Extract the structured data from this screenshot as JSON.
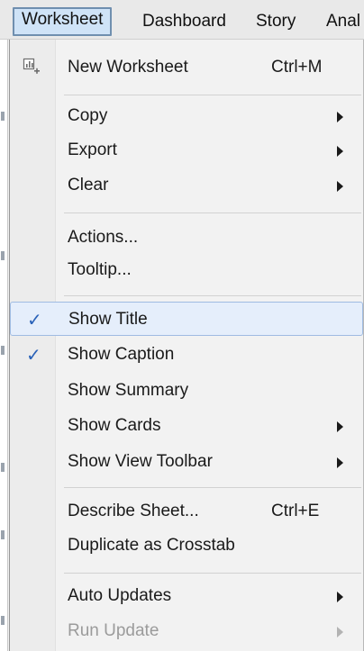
{
  "menubar": {
    "items": [
      {
        "label": "Worksheet"
      },
      {
        "label": "Dashboard"
      },
      {
        "label": "Story"
      },
      {
        "label": "Anal"
      }
    ]
  },
  "menu": {
    "new_worksheet": {
      "label": "New Worksheet",
      "shortcut": "Ctrl+M",
      "icon": "new-worksheet-icon"
    },
    "copy": {
      "label": "Copy"
    },
    "export": {
      "label": "Export"
    },
    "clear": {
      "label": "Clear"
    },
    "actions": {
      "label": "Actions..."
    },
    "tooltip": {
      "label": "Tooltip..."
    },
    "show_title": {
      "label": "Show Title",
      "checked": true
    },
    "show_caption": {
      "label": "Show Caption",
      "checked": true
    },
    "show_summary": {
      "label": "Show Summary"
    },
    "show_cards": {
      "label": "Show Cards"
    },
    "show_view_toolbar": {
      "label": "Show View Toolbar"
    },
    "describe_sheet": {
      "label": "Describe Sheet...",
      "shortcut": "Ctrl+E"
    },
    "duplicate_crosstab": {
      "label": "Duplicate as Crosstab"
    },
    "auto_updates": {
      "label": "Auto Updates"
    },
    "run_update": {
      "label": "Run Update",
      "disabled": true
    }
  },
  "checkmark_glyph": "✓",
  "colors": {
    "highlight": "#e5eefb",
    "check": "#2a62b8",
    "active_menu": "#cfe3f7"
  }
}
